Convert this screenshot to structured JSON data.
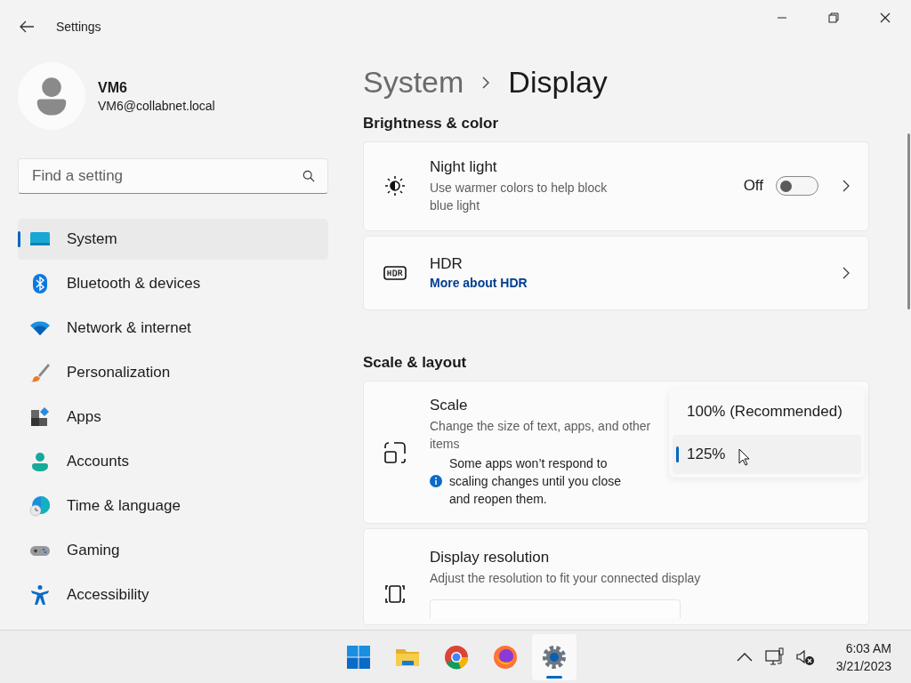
{
  "window": {
    "title": "Settings"
  },
  "user": {
    "name": "VM6",
    "email": "VM6@collabnet.local"
  },
  "search": {
    "placeholder": "Find a setting"
  },
  "sidebar": {
    "items": [
      {
        "label": "System",
        "selected": true
      },
      {
        "label": "Bluetooth & devices",
        "selected": false
      },
      {
        "label": "Network & internet",
        "selected": false
      },
      {
        "label": "Personalization",
        "selected": false
      },
      {
        "label": "Apps",
        "selected": false
      },
      {
        "label": "Accounts",
        "selected": false
      },
      {
        "label": "Time & language",
        "selected": false
      },
      {
        "label": "Gaming",
        "selected": false
      },
      {
        "label": "Accessibility",
        "selected": false
      }
    ]
  },
  "breadcrumb": [
    "System",
    "Display"
  ],
  "sections": [
    {
      "title": "Brightness & color",
      "cards": [
        {
          "kind": "toggle",
          "title": "Night light",
          "description": "Use warmer colors to help block blue light",
          "state_label": "Off",
          "on": false
        },
        {
          "kind": "link",
          "title": "HDR",
          "link": "More about HDR"
        }
      ]
    },
    {
      "title": "Scale & layout",
      "cards": [
        {
          "kind": "scale",
          "title": "Scale",
          "description": "Change the size of text, apps, and other items",
          "note": "Some apps won’t respond to scaling changes until you close and reopen them.",
          "expanded": true,
          "options": [
            {
              "label": "100% (Recommended)",
              "selected": false
            },
            {
              "label": "125%",
              "selected": true
            }
          ]
        },
        {
          "kind": "resolution",
          "title": "Display resolution",
          "description": "Adjust the resolution to fit your connected display"
        }
      ]
    }
  ],
  "taskbar": {
    "apps": [
      {
        "active": false
      },
      {
        "active": false
      },
      {
        "active": false
      },
      {
        "active": false
      },
      {
        "active": true
      }
    ],
    "time": "6:03 AM",
    "date": "3/21/2023"
  }
}
